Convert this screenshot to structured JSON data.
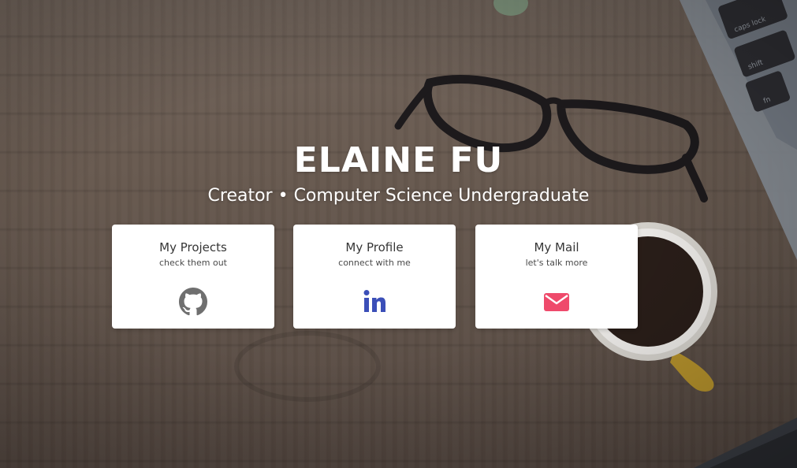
{
  "hero": {
    "name": "ELAINE FU",
    "tagline": "Creator • Computer Science Undergraduate"
  },
  "cards": [
    {
      "title": "My Projects",
      "subtitle": "check them out",
      "icon": "github-icon",
      "color": "#6f6f6f"
    },
    {
      "title": "My Profile",
      "subtitle": "connect with me",
      "icon": "linkedin-icon",
      "color": "#3b4fb8"
    },
    {
      "title": "My Mail",
      "subtitle": "let's talk more",
      "icon": "envelope-icon",
      "color": "#ef4a6b"
    }
  ],
  "background": {
    "keyboard_keys": [
      "caps lock",
      "shift",
      "fn"
    ]
  }
}
